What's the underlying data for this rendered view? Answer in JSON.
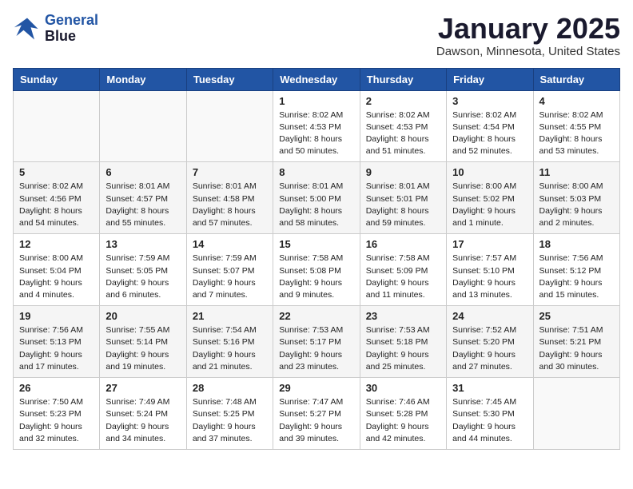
{
  "logo": {
    "line1": "General",
    "line2": "Blue"
  },
  "title": "January 2025",
  "location": "Dawson, Minnesota, United States",
  "weekdays": [
    "Sunday",
    "Monday",
    "Tuesday",
    "Wednesday",
    "Thursday",
    "Friday",
    "Saturday"
  ],
  "weeks": [
    [
      {
        "day": "",
        "info": ""
      },
      {
        "day": "",
        "info": ""
      },
      {
        "day": "",
        "info": ""
      },
      {
        "day": "1",
        "info": "Sunrise: 8:02 AM\nSunset: 4:53 PM\nDaylight: 8 hours\nand 50 minutes."
      },
      {
        "day": "2",
        "info": "Sunrise: 8:02 AM\nSunset: 4:53 PM\nDaylight: 8 hours\nand 51 minutes."
      },
      {
        "day": "3",
        "info": "Sunrise: 8:02 AM\nSunset: 4:54 PM\nDaylight: 8 hours\nand 52 minutes."
      },
      {
        "day": "4",
        "info": "Sunrise: 8:02 AM\nSunset: 4:55 PM\nDaylight: 8 hours\nand 53 minutes."
      }
    ],
    [
      {
        "day": "5",
        "info": "Sunrise: 8:02 AM\nSunset: 4:56 PM\nDaylight: 8 hours\nand 54 minutes."
      },
      {
        "day": "6",
        "info": "Sunrise: 8:01 AM\nSunset: 4:57 PM\nDaylight: 8 hours\nand 55 minutes."
      },
      {
        "day": "7",
        "info": "Sunrise: 8:01 AM\nSunset: 4:58 PM\nDaylight: 8 hours\nand 57 minutes."
      },
      {
        "day": "8",
        "info": "Sunrise: 8:01 AM\nSunset: 5:00 PM\nDaylight: 8 hours\nand 58 minutes."
      },
      {
        "day": "9",
        "info": "Sunrise: 8:01 AM\nSunset: 5:01 PM\nDaylight: 8 hours\nand 59 minutes."
      },
      {
        "day": "10",
        "info": "Sunrise: 8:00 AM\nSunset: 5:02 PM\nDaylight: 9 hours\nand 1 minute."
      },
      {
        "day": "11",
        "info": "Sunrise: 8:00 AM\nSunset: 5:03 PM\nDaylight: 9 hours\nand 2 minutes."
      }
    ],
    [
      {
        "day": "12",
        "info": "Sunrise: 8:00 AM\nSunset: 5:04 PM\nDaylight: 9 hours\nand 4 minutes."
      },
      {
        "day": "13",
        "info": "Sunrise: 7:59 AM\nSunset: 5:05 PM\nDaylight: 9 hours\nand 6 minutes."
      },
      {
        "day": "14",
        "info": "Sunrise: 7:59 AM\nSunset: 5:07 PM\nDaylight: 9 hours\nand 7 minutes."
      },
      {
        "day": "15",
        "info": "Sunrise: 7:58 AM\nSunset: 5:08 PM\nDaylight: 9 hours\nand 9 minutes."
      },
      {
        "day": "16",
        "info": "Sunrise: 7:58 AM\nSunset: 5:09 PM\nDaylight: 9 hours\nand 11 minutes."
      },
      {
        "day": "17",
        "info": "Sunrise: 7:57 AM\nSunset: 5:10 PM\nDaylight: 9 hours\nand 13 minutes."
      },
      {
        "day": "18",
        "info": "Sunrise: 7:56 AM\nSunset: 5:12 PM\nDaylight: 9 hours\nand 15 minutes."
      }
    ],
    [
      {
        "day": "19",
        "info": "Sunrise: 7:56 AM\nSunset: 5:13 PM\nDaylight: 9 hours\nand 17 minutes."
      },
      {
        "day": "20",
        "info": "Sunrise: 7:55 AM\nSunset: 5:14 PM\nDaylight: 9 hours\nand 19 minutes."
      },
      {
        "day": "21",
        "info": "Sunrise: 7:54 AM\nSunset: 5:16 PM\nDaylight: 9 hours\nand 21 minutes."
      },
      {
        "day": "22",
        "info": "Sunrise: 7:53 AM\nSunset: 5:17 PM\nDaylight: 9 hours\nand 23 minutes."
      },
      {
        "day": "23",
        "info": "Sunrise: 7:53 AM\nSunset: 5:18 PM\nDaylight: 9 hours\nand 25 minutes."
      },
      {
        "day": "24",
        "info": "Sunrise: 7:52 AM\nSunset: 5:20 PM\nDaylight: 9 hours\nand 27 minutes."
      },
      {
        "day": "25",
        "info": "Sunrise: 7:51 AM\nSunset: 5:21 PM\nDaylight: 9 hours\nand 30 minutes."
      }
    ],
    [
      {
        "day": "26",
        "info": "Sunrise: 7:50 AM\nSunset: 5:23 PM\nDaylight: 9 hours\nand 32 minutes."
      },
      {
        "day": "27",
        "info": "Sunrise: 7:49 AM\nSunset: 5:24 PM\nDaylight: 9 hours\nand 34 minutes."
      },
      {
        "day": "28",
        "info": "Sunrise: 7:48 AM\nSunset: 5:25 PM\nDaylight: 9 hours\nand 37 minutes."
      },
      {
        "day": "29",
        "info": "Sunrise: 7:47 AM\nSunset: 5:27 PM\nDaylight: 9 hours\nand 39 minutes."
      },
      {
        "day": "30",
        "info": "Sunrise: 7:46 AM\nSunset: 5:28 PM\nDaylight: 9 hours\nand 42 minutes."
      },
      {
        "day": "31",
        "info": "Sunrise: 7:45 AM\nSunset: 5:30 PM\nDaylight: 9 hours\nand 44 minutes."
      },
      {
        "day": "",
        "info": ""
      }
    ]
  ]
}
